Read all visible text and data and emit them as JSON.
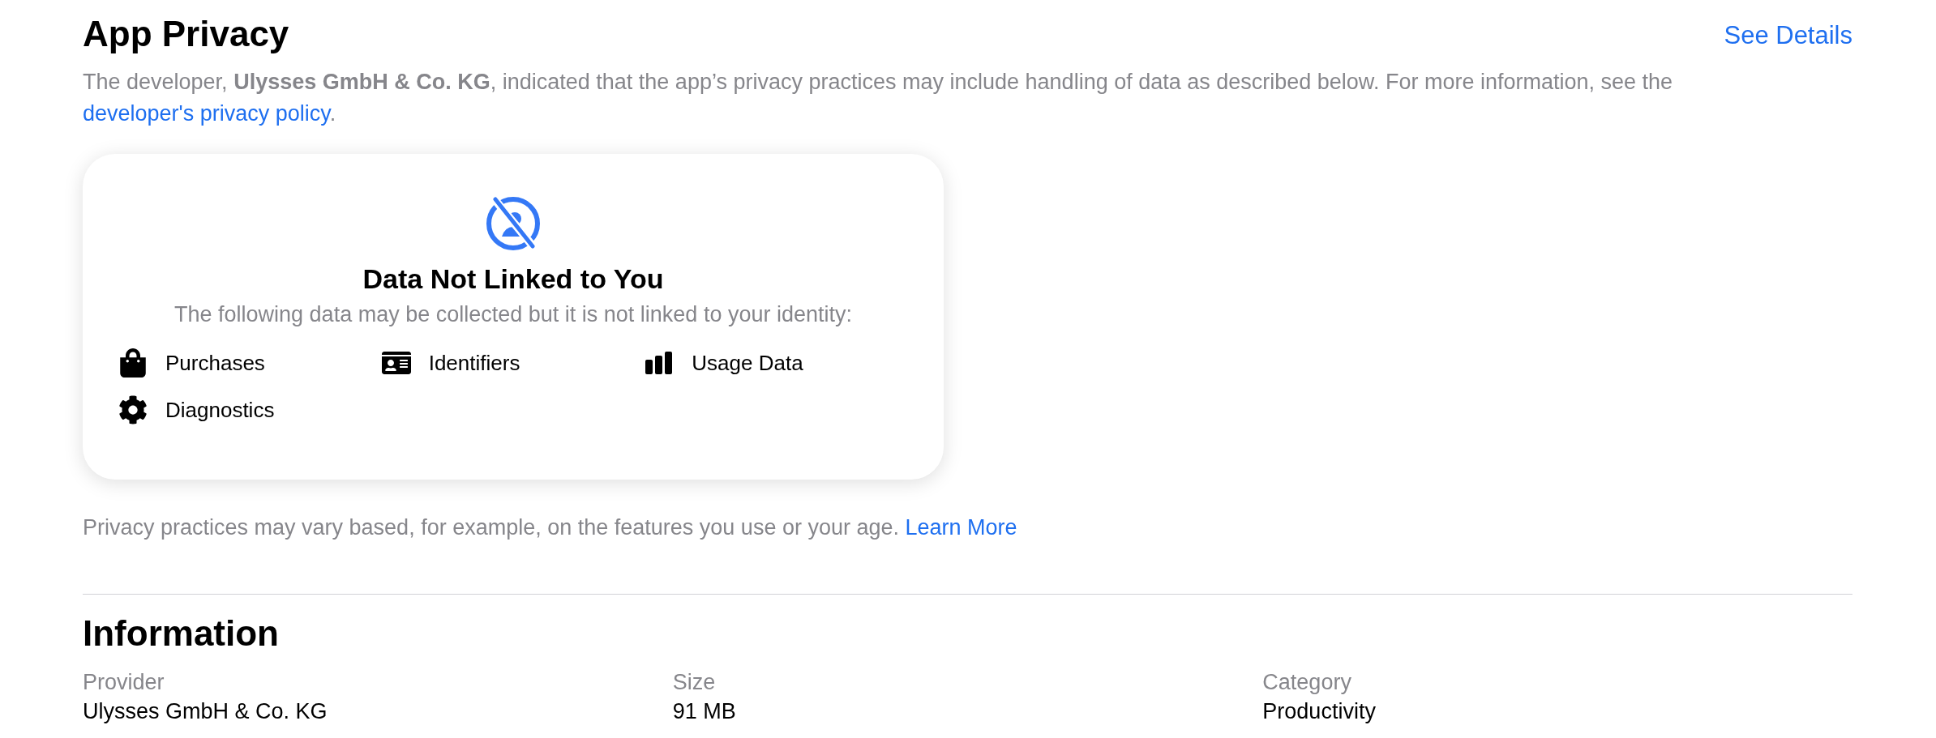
{
  "privacy": {
    "title": "App Privacy",
    "details_link": "See Details",
    "intro": {
      "text": "The developer, **Ulysses GmbH & Co. KG**, indicated that the app’s privacy practices may include handling of data as described below. For more information, see the",
      "link": "developer's privacy policy",
      "end": "."
    },
    "card": {
      "title": "Data Not Linked to You",
      "subtitle": "The following data may be collected but it is not linked to your identity:",
      "items": [
        {
          "kind": "purchases",
          "label": "Purchases"
        },
        {
          "kind": "identifiers",
          "label": "Identifiers"
        },
        {
          "kind": "usage",
          "label": "Usage Data"
        },
        {
          "kind": "diagnostics",
          "label": "Diagnostics"
        }
      ]
    },
    "note": {
      "text": "Privacy practices may vary based, for example, on the features you use or your age.",
      "link": "Learn More"
    }
  },
  "information": {
    "title": "Information",
    "fields": [
      {
        "label": "Provider",
        "value": "Ulysses GmbH & Co. KG"
      },
      {
        "label": "Size",
        "value": "91 MB"
      },
      {
        "label": "Category",
        "value": "Productivity"
      }
    ]
  }
}
